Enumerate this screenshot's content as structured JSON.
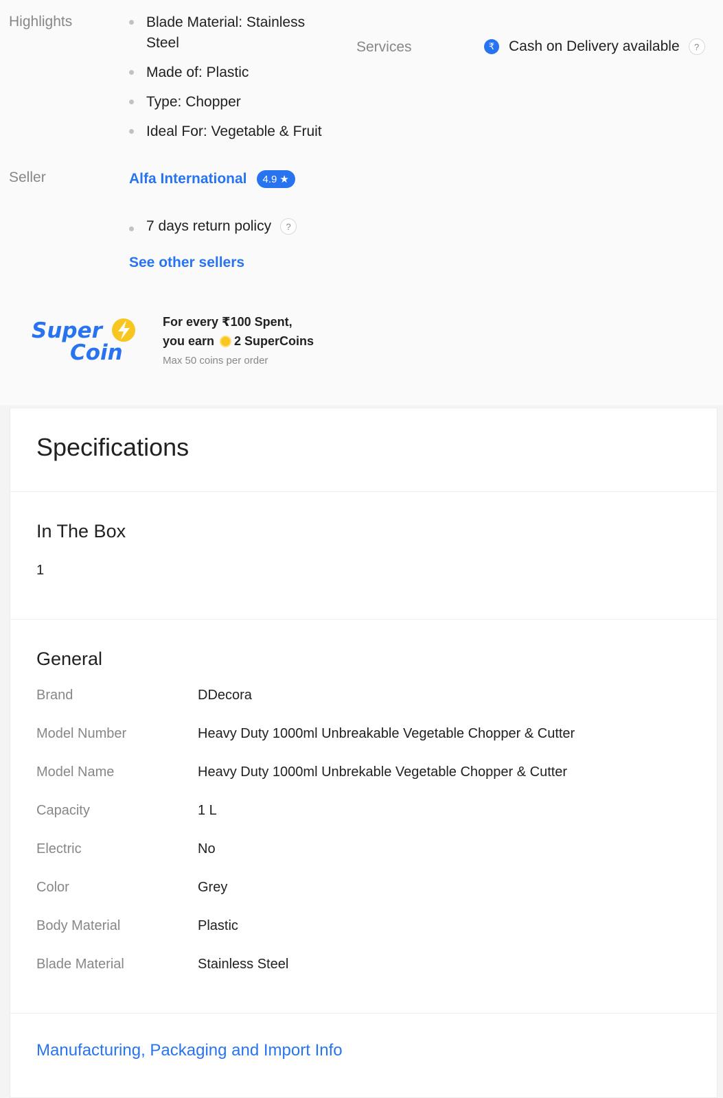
{
  "highlights": {
    "label": "Highlights",
    "items": [
      "Blade Material: Stainless Steel",
      "Made of: Plastic",
      "Type: Chopper",
      "Ideal For: Vegetable & Fruit"
    ]
  },
  "services": {
    "label": "Services",
    "cod_text": "Cash on Delivery available",
    "rupee_symbol": "₹",
    "help_symbol": "?"
  },
  "seller": {
    "label": "Seller",
    "name": "Alfa International",
    "rating": "4.9",
    "rating_star": "★",
    "policy": "7 days return policy",
    "help_symbol": "?",
    "see_other": "See other sellers"
  },
  "supercoin": {
    "logo_line1": "Super",
    "logo_line2": "Coin",
    "line1": "For every ₹100 Spent,",
    "line2_prefix": "you earn",
    "line2_suffix": "2 SuperCoins",
    "sub": "Max 50 coins per order"
  },
  "specifications": {
    "title": "Specifications",
    "in_the_box": {
      "title": "In The Box",
      "value": "1"
    },
    "general": {
      "title": "General",
      "rows": [
        {
          "key": "Brand",
          "value": "DDecora"
        },
        {
          "key": "Model Number",
          "value": "Heavy Duty 1000ml Unbreakable Vegetable Chopper & Cutter"
        },
        {
          "key": "Model Name",
          "value": "Heavy Duty 1000ml Unbrekable Vegetable Chopper & Cutter"
        },
        {
          "key": "Capacity",
          "value": "1 L"
        },
        {
          "key": "Electric",
          "value": "No"
        },
        {
          "key": "Color",
          "value": "Grey"
        },
        {
          "key": "Body Material",
          "value": "Plastic"
        },
        {
          "key": "Blade Material",
          "value": "Stainless Steel"
        }
      ]
    },
    "more_link": "Manufacturing, Packaging and Import Info"
  },
  "colors": {
    "accent": "#2874f0",
    "muted": "#878787",
    "coin_yellow": "#f8c620"
  }
}
